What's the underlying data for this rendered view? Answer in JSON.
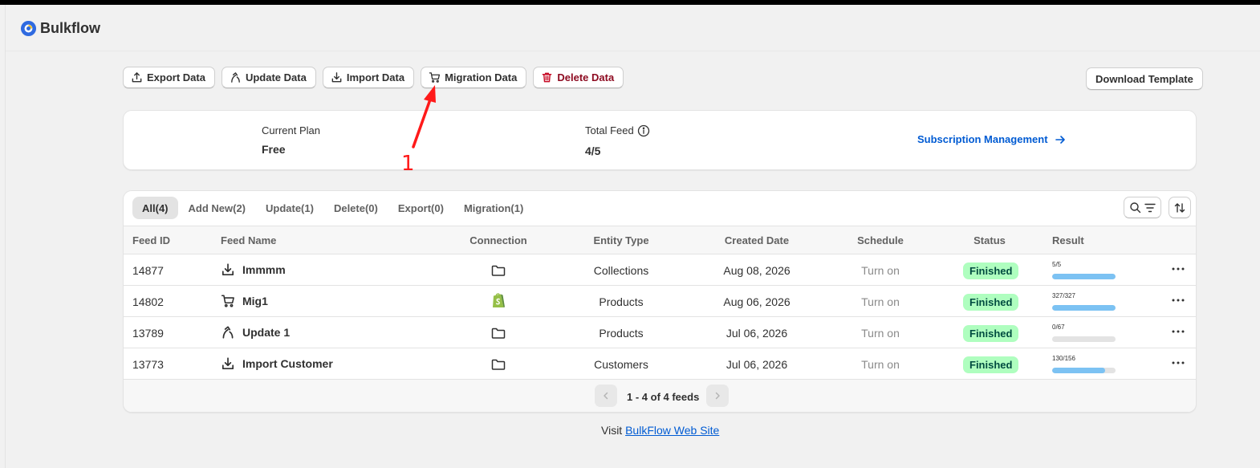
{
  "app": {
    "name": "Bulkflow"
  },
  "toolbar": {
    "export_label": "Export Data",
    "update_label": "Update Data",
    "import_label": "Import Data",
    "migration_label": "Migration Data",
    "delete_label": "Delete Data",
    "template_label": "Download Template"
  },
  "plan": {
    "current_label": "Current Plan",
    "current_value": "Free",
    "total_label": "Total Feed",
    "total_value": "4/5",
    "subscription_link": "Subscription Management"
  },
  "tabs": [
    "All(4)",
    "Add New(2)",
    "Update(1)",
    "Delete(0)",
    "Export(0)",
    "Migration(1)"
  ],
  "columns": [
    "Feed ID",
    "Feed Name",
    "Connection",
    "Entity Type",
    "Created Date",
    "Schedule",
    "Status",
    "Result"
  ],
  "rows": [
    {
      "id": "14877",
      "name": "Immmm",
      "type_icon": "import-icon",
      "connection": "folder-icon",
      "entity": "Collections",
      "date": "Aug 08, 2026",
      "schedule": "Turn on",
      "status": "Finished",
      "result": "5/5",
      "progress": 1.0
    },
    {
      "id": "14802",
      "name": "Mig1",
      "type_icon": "cart-icon",
      "connection": "shopify-icon",
      "entity": "Products",
      "date": "Aug 06, 2026",
      "schedule": "Turn on",
      "status": "Finished",
      "result": "327/327",
      "progress": 1.0
    },
    {
      "id": "13789",
      "name": "Update 1",
      "type_icon": "update-icon",
      "connection": "folder-icon",
      "entity": "Products",
      "date": "Jul 06, 2026",
      "schedule": "Turn on",
      "status": "Finished",
      "result": "0/67",
      "progress": 0.0
    },
    {
      "id": "13773",
      "name": "Import Customer",
      "type_icon": "import-icon",
      "connection": "folder-icon",
      "entity": "Customers",
      "date": "Jul 06, 2026",
      "schedule": "Turn on",
      "status": "Finished",
      "result": "130/156",
      "progress": 0.833
    }
  ],
  "pagination": {
    "text": "1 - 4 of 4 feeds"
  },
  "footer": {
    "prefix": "Visit",
    "link": "BulkFlow Web Site"
  },
  "annotation": {
    "label": "1",
    "color": "#ff1a1a"
  },
  "colors": {
    "accent": "#005bd3",
    "success_bg": "#affebf",
    "success_text": "#014b40",
    "danger": "#8e0b21",
    "progress": "#7cc2f3"
  }
}
